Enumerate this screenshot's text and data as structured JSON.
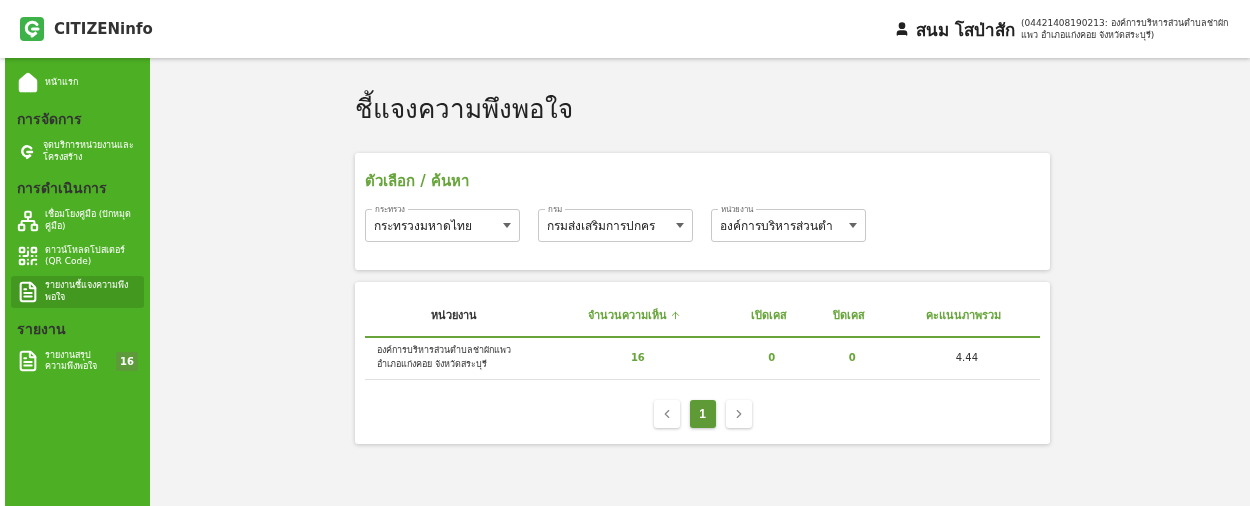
{
  "header": {
    "brand": "CITIZENinfo",
    "user": {
      "name": "สนม โสป่าสัก",
      "detail": "(04421408190213: องค์การบริหารส่วนตำบลช่าผักแพว อำเภอแก่งคอย จังหวัดสระบุรี)"
    }
  },
  "sidebar": {
    "items": [
      {
        "kind": "link",
        "label": "หน้าแรก",
        "selected": false
      },
      {
        "kind": "heading",
        "label": "การจัดการ"
      },
      {
        "kind": "link",
        "label": "จุดบริการหน่วยงานและโครงสร้าง",
        "selected": false
      },
      {
        "kind": "heading",
        "label": "การดำเนินการ"
      },
      {
        "kind": "link",
        "label": "เชื่อมโยงคู่มือ (ปักหมุดคู่มือ)",
        "selected": false
      },
      {
        "kind": "link",
        "label": "ดาวน์โหลดโปสเตอร์ (QR Code)",
        "selected": false
      },
      {
        "kind": "link",
        "label": "รายงานชี้แจงความพึงพอใจ",
        "selected": true
      },
      {
        "kind": "heading",
        "label": "รายงาน"
      },
      {
        "kind": "link",
        "label": "รายงานสรุปความพึงพอใจ",
        "selected": false,
        "badge": "16"
      }
    ]
  },
  "page_title": "ชี้แจงความพึงพอใจ",
  "filters": {
    "title": "ตัวเลือก / ค้นหา",
    "selects": [
      {
        "label": "กระทรวง",
        "value": "กระทรวงมหาดไทย"
      },
      {
        "label": "กรม",
        "value": "กรมส่งเสริมการปกคร"
      },
      {
        "label": "หน่วยงาน",
        "value": "องค์การบริหารส่วนตำ"
      }
    ]
  },
  "table": {
    "columns": [
      {
        "label": "หน่วยงาน",
        "kind": "name",
        "sorted": false
      },
      {
        "label": "จำนวนความเห็น",
        "kind": "count",
        "sorted": true
      },
      {
        "label": "เปิดเคส",
        "kind": "count",
        "sorted": false
      },
      {
        "label": "ปิดเคส",
        "kind": "count",
        "sorted": false
      },
      {
        "label": "คะแนนภาพรวม",
        "kind": "score",
        "sorted": false
      }
    ],
    "rows": [
      [
        "องค์การบริหารส่วนตำบลช่าผักแพว อำเภอแก่งคอย จังหวัดสระบุรี",
        "16",
        "0",
        "0",
        "4.44"
      ]
    ]
  },
  "pagination": {
    "pages": [
      {
        "label": "1",
        "selected": true
      }
    ]
  }
}
